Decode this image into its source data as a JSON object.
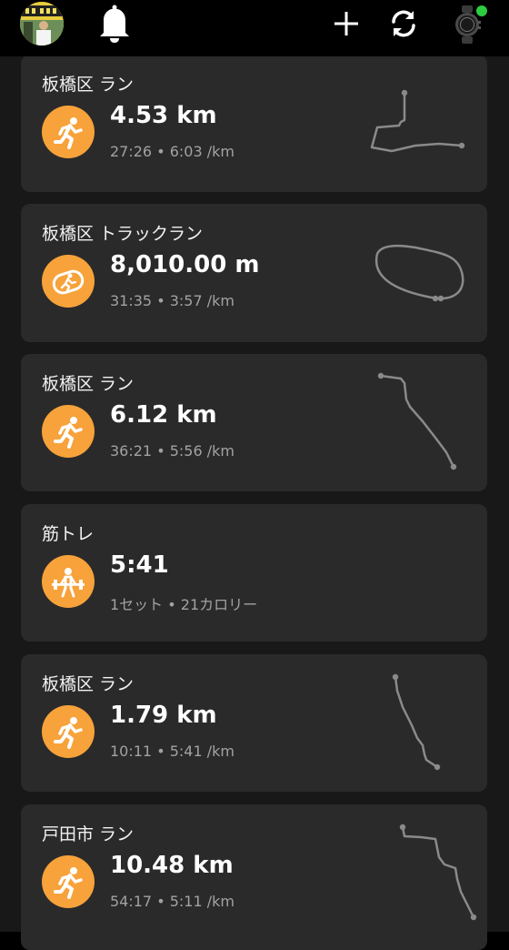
{
  "header": {
    "avatar_icon": "profile-avatar",
    "notifications_icon": "bell-icon",
    "add_icon": "plus-icon",
    "sync_icon": "sync-icon",
    "device_icon": "watch-icon",
    "device_status_color": "#2ecc40"
  },
  "theme": {
    "accent": "#f7a23a",
    "card_bg": "#2a2a2a",
    "page_bg": "#181818"
  },
  "activities": [
    {
      "title": "板橋区 ラン",
      "value": "4.53 km",
      "stats": "27:26 • 6:03 /km",
      "icon": "running-icon",
      "has_route": true
    },
    {
      "title": "板橋区 トラックラン",
      "value": "8,010.00 m",
      "stats": "31:35 • 3:57 /km",
      "icon": "track-run-icon",
      "has_route": true
    },
    {
      "title": "板橋区 ラン",
      "value": "6.12 km",
      "stats": "36:21 • 5:56 /km",
      "icon": "running-icon",
      "has_route": true
    },
    {
      "title": "筋トレ",
      "value": "5:41",
      "stats": "1セット • 21カロリー",
      "icon": "weightlifting-icon",
      "has_route": false
    },
    {
      "title": "板橋区 ラン",
      "value": "1.79 km",
      "stats": "10:11 • 5:41 /km",
      "icon": "running-icon",
      "has_route": true
    },
    {
      "title": "戸田市 ラン",
      "value": "10.48 km",
      "stats": "54:17 • 5:11 /km",
      "icon": "running-icon",
      "has_route": true
    }
  ]
}
